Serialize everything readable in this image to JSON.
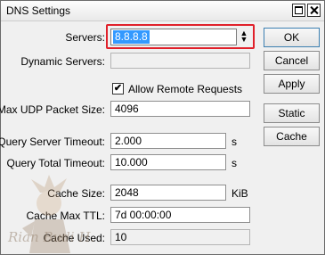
{
  "window": {
    "title": "DNS Settings"
  },
  "form": {
    "servers": {
      "label": "Servers:",
      "value": "8.8.8.8"
    },
    "dynamic_servers": {
      "label": "Dynamic Servers:",
      "value": ""
    },
    "allow_remote": {
      "label": "Allow Remote Requests",
      "checked": true,
      "check_glyph": "✔"
    },
    "max_udp": {
      "label": "Max UDP Packet Size:",
      "value": "4096"
    },
    "query_server_timeout": {
      "label": "Query Server Timeout:",
      "value": "2.000",
      "unit": "s"
    },
    "query_total_timeout": {
      "label": "Query Total Timeout:",
      "value": "10.000",
      "unit": "s"
    },
    "cache_size": {
      "label": "Cache Size:",
      "value": "2048",
      "unit": "KiB"
    },
    "cache_max_ttl": {
      "label": "Cache Max TTL:",
      "value": "7d 00:00:00"
    },
    "cache_used": {
      "label": "Cache Used:",
      "value": "10"
    }
  },
  "buttons": {
    "ok": "OK",
    "cancel": "Cancel",
    "apply": "Apply",
    "static": "Static",
    "cache": "Cache"
  },
  "watermark": {
    "text": "Rian Budi H."
  },
  "colors": {
    "highlight": "#e0202a",
    "selection": "#3399ff"
  }
}
